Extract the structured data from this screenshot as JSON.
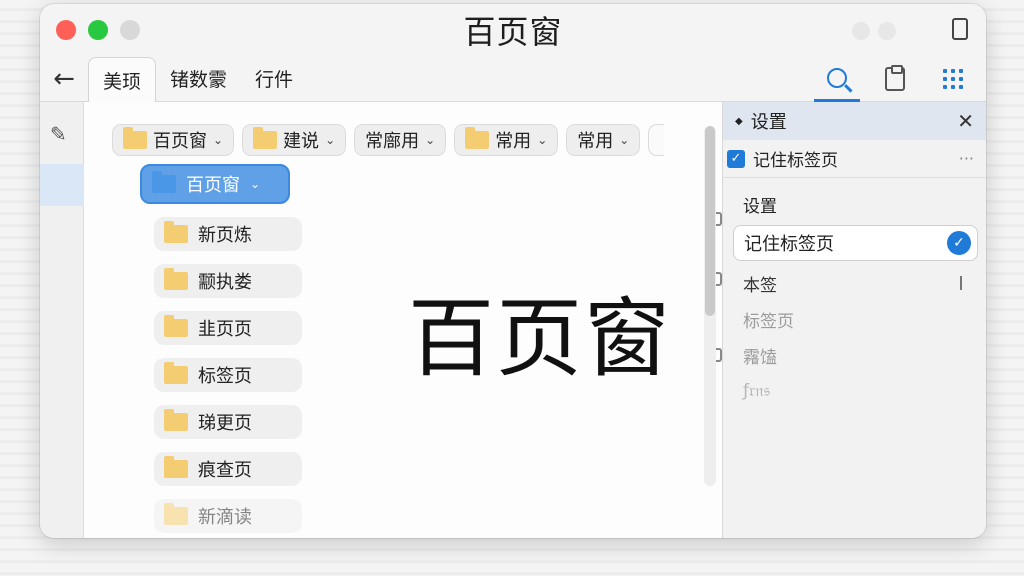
{
  "window": {
    "title": "百页窗"
  },
  "tabs": [
    {
      "label": "美顼",
      "active": true
    },
    {
      "label": "锗数霥",
      "active": false
    },
    {
      "label": "行件",
      "active": false
    }
  ],
  "toolbar_icons": [
    "search-icon",
    "clipboard-icon",
    "grid-icon"
  ],
  "breadcrumbs": [
    {
      "label": "百页窗",
      "folder": true
    },
    {
      "label": "建说",
      "folder": true
    },
    {
      "label": "常廍用",
      "folder": false
    },
    {
      "label": "常用",
      "folder": true
    },
    {
      "label": "常用",
      "folder": false
    }
  ],
  "tree": {
    "selected": "百页窗",
    "items": [
      "新页炼",
      "颥执娄",
      "韭页页",
      "标签页",
      "珶更页",
      "痕查页",
      "新滴读"
    ]
  },
  "main": {
    "big_title": "百页窗"
  },
  "settings_panel": {
    "title": "设置",
    "remember_label": "记住标签页",
    "section_label": "设置",
    "field_value": "记住标签页",
    "items": [
      "本签",
      "标签页",
      "霿馌",
      "ƒ𝔯𝔫𝔰"
    ]
  },
  "colors": {
    "accent": "#1f7ad8",
    "folder": "#f4cd72",
    "close": "#fe5f57",
    "maximize": "#28c840"
  }
}
